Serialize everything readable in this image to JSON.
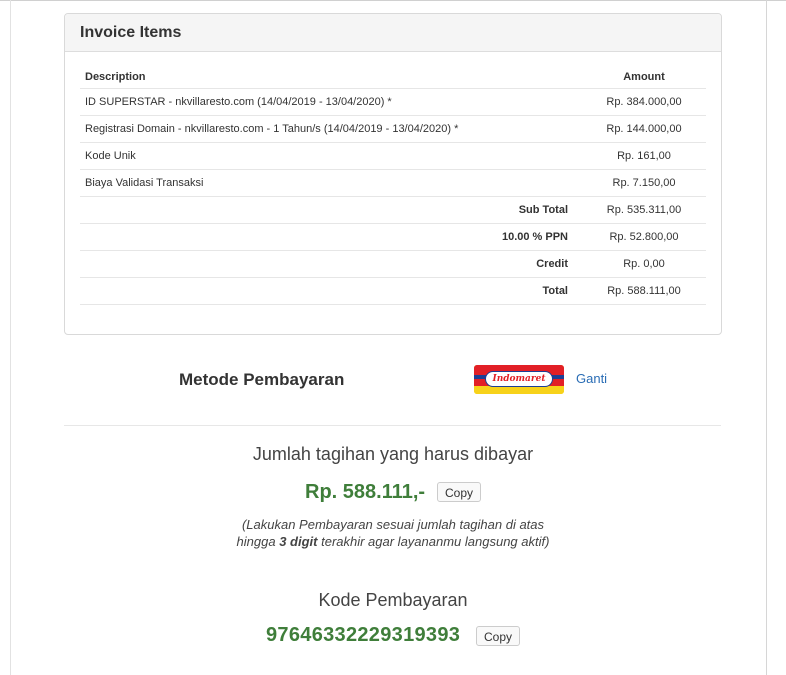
{
  "invoice": {
    "title": "Invoice Items",
    "columns": {
      "description": "Description",
      "amount": "Amount"
    },
    "items": [
      {
        "description": "ID SUPERSTAR - nkvillaresto.com (14/04/2019 - 13/04/2020) *",
        "amount": "Rp. 384.000,00"
      },
      {
        "description": "Registrasi Domain - nkvillaresto.com - 1 Tahun/s (14/04/2019 - 13/04/2020) *",
        "amount": "Rp. 144.000,00"
      },
      {
        "description": "Kode Unik",
        "amount": "Rp. 161,00"
      },
      {
        "description": "Biaya Validasi Transaksi",
        "amount": "Rp. 7.150,00"
      }
    ],
    "summary": [
      {
        "label": "Sub Total",
        "amount": "Rp. 535.311,00"
      },
      {
        "label": "10.00 % PPN",
        "amount": "Rp. 52.800,00"
      },
      {
        "label": "Credit",
        "amount": "Rp. 0,00"
      },
      {
        "label": "Total",
        "amount": "Rp. 588.111,00"
      }
    ]
  },
  "payment_method": {
    "title": "Metode Pembayaran",
    "logo_text": "Indomaret",
    "change_link": "Ganti"
  },
  "billing": {
    "label": "Jumlah tagihan yang harus dibayar",
    "amount": "Rp. 588.111,-",
    "copy_label": "Copy",
    "note_part1": "(Lakukan Pembayaran sesuai jumlah tagihan di atas hingga ",
    "note_bold": "3 digit",
    "note_part2": " terakhir agar layananmu langsung aktif)"
  },
  "payment_code": {
    "label": "Kode Pembayaran",
    "code": "97646332229319393",
    "copy_label": "Copy"
  },
  "colors": {
    "accent_green": "#3f7e3a",
    "link_blue": "#2a6db5"
  }
}
